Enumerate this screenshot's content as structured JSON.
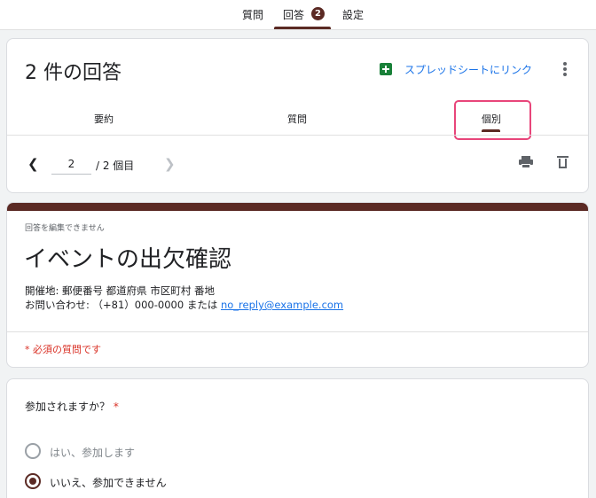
{
  "top_tabs": {
    "questions": "質問",
    "responses": "回答",
    "response_badge": "2",
    "settings": "設定"
  },
  "summary_card": {
    "title": "2 件の回答",
    "spreadsheet_link": "スプレッドシートにリンク",
    "tabs": {
      "summary": "要約",
      "question": "質問",
      "individual": "個別"
    },
    "pager": {
      "current": "2",
      "of_text": "/  2 個目"
    }
  },
  "form_card": {
    "cannot_edit": "回答を編集できません",
    "title": "イベントの出欠確認",
    "desc_line1": "開催地: 郵便番号 都道府県 市区町村 番地",
    "desc_line2_prefix": "お問い合わせ: （+81）000-0000 または ",
    "desc_email": "no_reply@example.com",
    "required_note": "* 必須の質問です"
  },
  "question_card": {
    "question": "参加されますか？",
    "required_mark": "*",
    "options": [
      {
        "label": "はい、参加します",
        "selected": false
      },
      {
        "label": "いいえ、参加できません",
        "selected": true
      }
    ]
  },
  "colors": {
    "accent": "#5b2a24",
    "link": "#1a73e8",
    "highlight": "#e8457a",
    "required": "#d93025"
  }
}
